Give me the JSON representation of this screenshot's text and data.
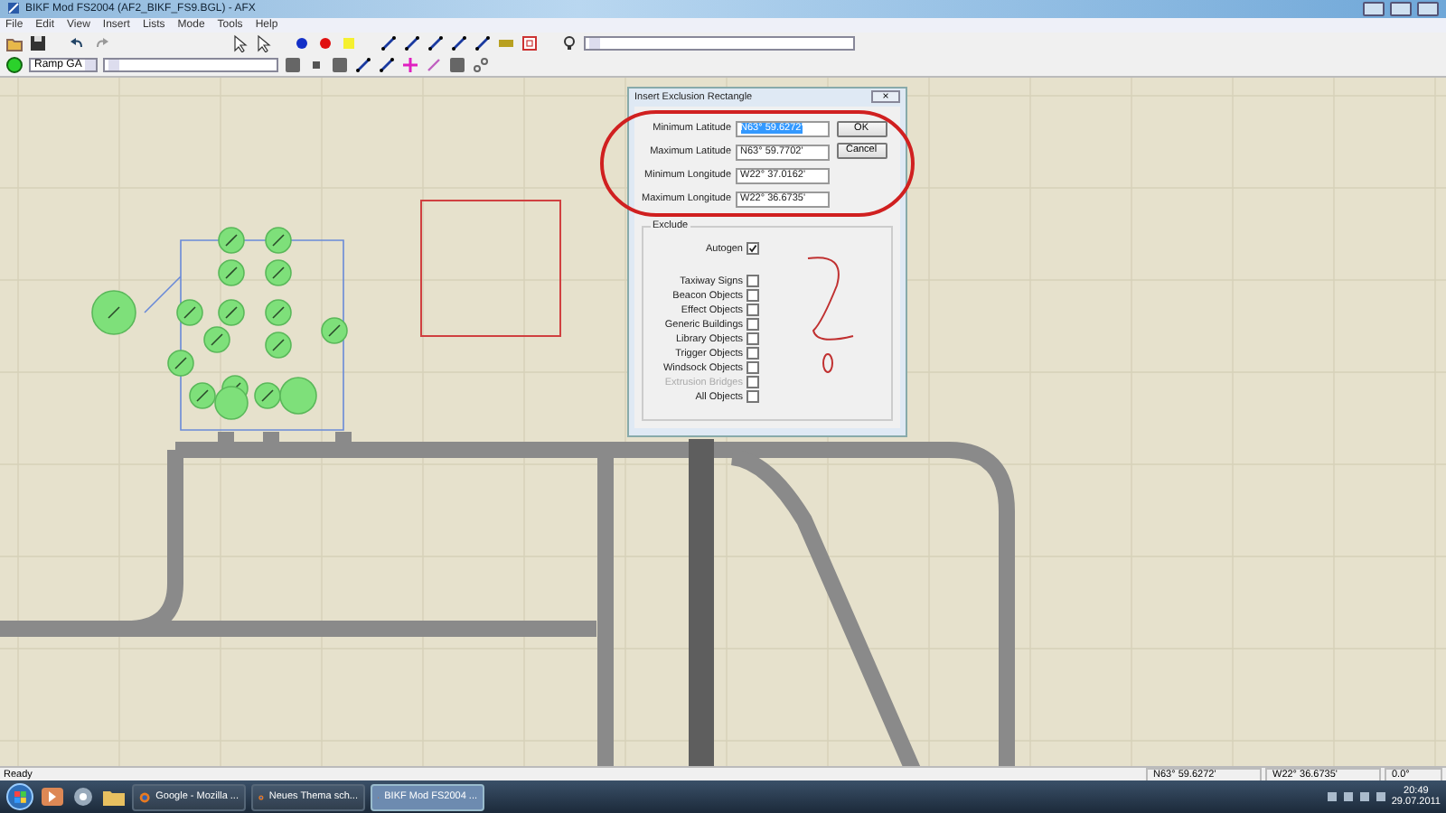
{
  "window": {
    "title": "BIKF Mod FS2004 (AF2_BIKF_FS9.BGL) - AFX"
  },
  "menu": [
    "File",
    "Edit",
    "View",
    "Insert",
    "Lists",
    "Mode",
    "Tools",
    "Help"
  ],
  "toolbar": {
    "layer_combo": "Ramp GA"
  },
  "dialog": {
    "title": "Insert Exclusion Rectangle",
    "close": "×",
    "fields": [
      {
        "label": "Minimum Latitude",
        "value": "N63° 59.6272'",
        "selected": true
      },
      {
        "label": "Maximum Latitude",
        "value": "N63° 59.7702'",
        "selected": false
      },
      {
        "label": "Minimum Longitude",
        "value": "W22° 37.0162'",
        "selected": false
      },
      {
        "label": "Maximum Longitude",
        "value": "W22° 36.6735'",
        "selected": false
      }
    ],
    "buttons": [
      "OK",
      "Cancel"
    ],
    "group": "Exclude",
    "checks": [
      {
        "label": "Autogen",
        "checked": true,
        "disabled": false
      },
      {
        "label": "Taxiway Signs",
        "checked": false,
        "disabled": false
      },
      {
        "label": "Beacon Objects",
        "checked": false,
        "disabled": false
      },
      {
        "label": "Effect Objects",
        "checked": false,
        "disabled": false
      },
      {
        "label": "Generic Buildings",
        "checked": false,
        "disabled": false
      },
      {
        "label": "Library Objects",
        "checked": false,
        "disabled": false
      },
      {
        "label": "Trigger Objects",
        "checked": false,
        "disabled": false
      },
      {
        "label": "Windsock Objects",
        "checked": false,
        "disabled": false
      },
      {
        "label": "Extrusion Bridges",
        "checked": false,
        "disabled": true
      },
      {
        "label": "All Objects",
        "checked": false,
        "disabled": false
      }
    ]
  },
  "status_bar": {
    "message": "Ready",
    "latitude": "N63° 59.6272'",
    "longitude": "W22° 36.6735'",
    "heading": "0.0°"
  },
  "taskbar": {
    "items": [
      {
        "label": "Google - Mozilla ...",
        "selected": false
      },
      {
        "label": "Neues Thema sch...",
        "selected": false
      },
      {
        "label": "BIKF Mod FS2004 ...",
        "selected": true
      }
    ],
    "time": "20:49",
    "date": "29.07.2011"
  }
}
